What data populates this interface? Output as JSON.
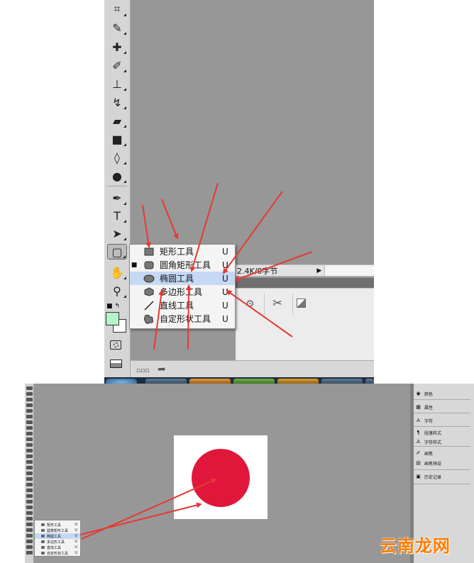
{
  "top_screenshot": {
    "toolbox": {
      "tools": [
        {
          "name": "crop-tool",
          "glyph": "⌗"
        },
        {
          "name": "eyedropper-tool",
          "glyph": "✎"
        },
        {
          "name": "spot-healing-tool",
          "glyph": "✚"
        },
        {
          "name": "brush-tool",
          "glyph": "✐"
        },
        {
          "name": "clone-stamp-tool",
          "glyph": "⊥"
        },
        {
          "name": "history-brush-tool",
          "glyph": "↯"
        },
        {
          "name": "eraser-tool",
          "glyph": "▰"
        },
        {
          "name": "gradient-tool",
          "glyph": "■"
        },
        {
          "name": "blur-tool",
          "glyph": "◊"
        },
        {
          "name": "dodge-tool",
          "glyph": "●"
        },
        {
          "name": "pen-tool",
          "glyph": "✒"
        },
        {
          "name": "type-tool",
          "glyph": "T"
        },
        {
          "name": "path-selection-tool",
          "glyph": "➤"
        },
        {
          "name": "shape-tool",
          "glyph": "▢"
        },
        {
          "name": "hand-tool",
          "glyph": "✋"
        },
        {
          "name": "zoom-tool",
          "glyph": "⚲"
        }
      ],
      "foreground_color": "#b3f5c8",
      "background_color": "#ffffff"
    },
    "shape_flyout": {
      "items": [
        {
          "label": "矩形工具",
          "key": "U",
          "icon": "rectangle-icon",
          "selected": false,
          "current": false
        },
        {
          "label": "圆角矩形工具",
          "key": "U",
          "icon": "rounded-rectangle-icon",
          "selected": false,
          "current": true
        },
        {
          "label": "椭圆工具",
          "key": "U",
          "icon": "ellipse-icon",
          "selected": true,
          "current": false
        },
        {
          "label": "多边形工具",
          "key": "U",
          "icon": "polygon-icon",
          "selected": false,
          "current": false
        },
        {
          "label": "直线工具",
          "key": "U",
          "icon": "line-icon",
          "selected": false,
          "current": false
        },
        {
          "label": "自定形状工具",
          "key": "U",
          "icon": "custom-shape-icon",
          "selected": false,
          "current": false
        }
      ]
    },
    "status_bar": {
      "text": "2.4K/0字节"
    },
    "annotation_color": "#e53935"
  },
  "bottom_screenshot": {
    "canvas": {
      "background": "#ffffff",
      "shape_color": "#e0163b",
      "shape": "circle"
    },
    "mini_flyout": {
      "items": [
        {
          "label": "矩形工具",
          "key": "U",
          "selected": false
        },
        {
          "label": "圆角矩形工具",
          "key": "U",
          "selected": false
        },
        {
          "label": "椭圆工具",
          "key": "U",
          "selected": true
        },
        {
          "label": "多边形工具",
          "key": "U",
          "selected": false
        },
        {
          "label": "直线工具",
          "key": "U",
          "selected": false
        },
        {
          "label": "自定形状工具",
          "key": "U",
          "selected": false
        }
      ]
    },
    "right_panel": {
      "items": [
        {
          "label": "颜色",
          "icon": "color-icon"
        },
        {
          "label": "属性",
          "icon": "properties-icon"
        },
        {
          "label": "字符",
          "icon": "character-icon"
        },
        {
          "label": "段落样式",
          "icon": "paragraph-style-icon"
        },
        {
          "label": "字符样式",
          "icon": "character-style-icon"
        },
        {
          "label": "画笔",
          "icon": "brush-icon"
        },
        {
          "label": "画笔预设",
          "icon": "brush-preset-icon"
        },
        {
          "label": "历史记录",
          "icon": "history-icon"
        }
      ]
    }
  },
  "watermark": {
    "text": "云南龙网",
    "color": "#ff7d00"
  }
}
